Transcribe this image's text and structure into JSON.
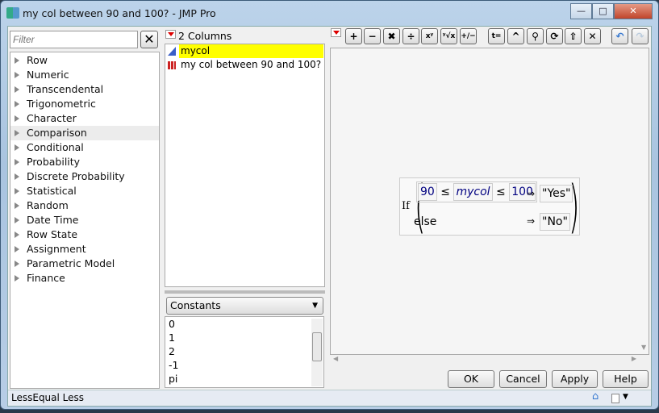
{
  "window": {
    "title": "my col between 90 and 100? - JMP Pro",
    "minimize": "—",
    "maximize": "□",
    "close": "✕"
  },
  "filter": {
    "placeholder": "Filter",
    "clear_label": "✕"
  },
  "functions": [
    "Row",
    "Numeric",
    "Transcendental",
    "Trigonometric",
    "Character",
    "Comparison",
    "Conditional",
    "Probability",
    "Discrete Probability",
    "Statistical",
    "Random",
    "Date Time",
    "Row State",
    "Assignment",
    "Parametric Model",
    "Finance"
  ],
  "columns": {
    "header": "2 Columns",
    "items": [
      {
        "name": "mycol",
        "selected": true,
        "icon": "continuous-icon"
      },
      {
        "name": "my col between 90 and 100?",
        "selected": false,
        "icon": "nominal-bar-icon"
      }
    ]
  },
  "constants": {
    "selected": "Constants",
    "items": [
      "0",
      "1",
      "2",
      "-1",
      "pi"
    ]
  },
  "toolbar": {
    "buttons": [
      {
        "name": "add",
        "glyph": "+"
      },
      {
        "name": "subtract",
        "glyph": "−"
      },
      {
        "name": "multiply",
        "glyph": "✖"
      },
      {
        "name": "divide",
        "glyph": "÷"
      },
      {
        "name": "power",
        "glyph": "xʸ"
      },
      {
        "name": "root",
        "glyph": "ʸ√x"
      },
      {
        "name": "negate",
        "glyph": "+∕−"
      },
      {
        "name": "assign",
        "glyph": "t="
      },
      {
        "name": "raise",
        "glyph": "^"
      },
      {
        "name": "peel",
        "glyph": "⚲"
      },
      {
        "name": "swap",
        "glyph": "⟳"
      },
      {
        "name": "unary",
        "glyph": "⇧"
      },
      {
        "name": "delete",
        "glyph": "✕"
      }
    ],
    "undo": "↶",
    "redo": "↷"
  },
  "formula": {
    "keyword": "If",
    "low": "90",
    "op1": "≤",
    "col": "mycol",
    "op2": "≤",
    "high": "100",
    "arrow": "⇒",
    "then": "\"Yes\"",
    "else": "else",
    "else_val": "\"No\""
  },
  "buttons": {
    "ok": "OK",
    "cancel": "Cancel",
    "apply": "Apply",
    "help": "Help"
  },
  "status": {
    "text": "LessEqual Less"
  },
  "colors": {
    "selection": "#ffff00",
    "formula_text": "#000080"
  }
}
